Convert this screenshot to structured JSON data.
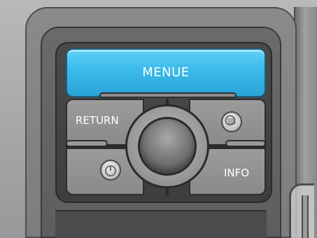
{
  "display": {
    "title": "MENUE"
  },
  "controls": {
    "return_label": "RETURN",
    "info_label": "INFO",
    "menu_icon": "menu-list-icon",
    "power_icon": "power-icon"
  },
  "colors": {
    "display_blue": "#3dbcec",
    "housing_gray": "#8a8a8a",
    "button_gray": "#9b9b9b"
  }
}
